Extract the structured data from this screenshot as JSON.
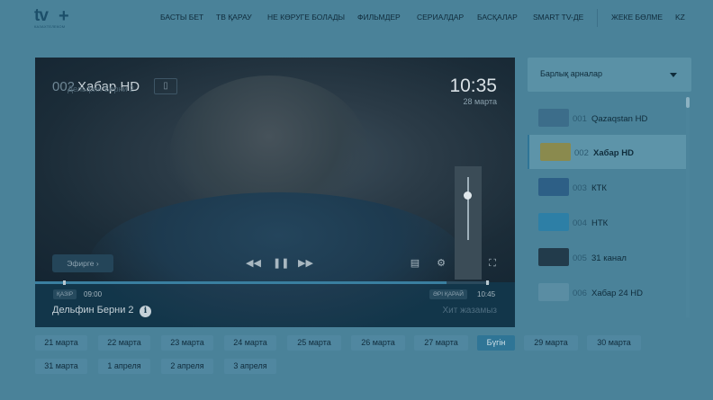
{
  "header": {
    "logo_main": "tv",
    "logo_plus": "+",
    "logo_sub": "КАЗАХТЕЛЕКОМ",
    "nav": [
      {
        "label": "БАСТЫ БЕТ"
      },
      {
        "label": "ТВ ҚАРАУ"
      },
      {
        "label": "НЕ КӨРУГЕ БОЛАДЫ"
      },
      {
        "label": "ФИЛЬМДЕР"
      },
      {
        "label": "СЕРИАЛДАР"
      },
      {
        "label": "БАСҚАЛАР"
      },
      {
        "label": "SMART TV-ДЕ"
      }
    ],
    "account": "ЖЕКЕ БӨЛМЕ",
    "lang": "KZ"
  },
  "player": {
    "channel_number": "002",
    "channel_name": "Хабар HD",
    "programme_ghost": "Дельфин Берни 2",
    "clock": "10:35",
    "date": "28 марта",
    "air_button": "Эфирге",
    "start_tag": "ҚАЗІР",
    "start_time": "09:00",
    "end_tag": "ӘРІ ҚАРАЙ",
    "end_time": "10:45",
    "programme_title": "Дельфин Берни 2",
    "programme_genre": "Хит жазамыз",
    "progress": 0.905,
    "volume": 0.75
  },
  "sidebar": {
    "dropdown_label": "Барлық арналар",
    "channels": [
      {
        "num": "001",
        "name": "Qazaqstan HD",
        "logo_color": "#3c6d8a"
      },
      {
        "num": "002",
        "name": "Хабар HD",
        "logo_color": "#8a8a4e",
        "active": true
      },
      {
        "num": "003",
        "name": "КТК",
        "logo_color": "#2d5f86"
      },
      {
        "num": "004",
        "name": "НТК",
        "logo_color": "#2d7fa6"
      },
      {
        "num": "005",
        "name": "31 канал",
        "logo_color": "#223b4b"
      },
      {
        "num": "006",
        "name": "Хабар 24 HD",
        "logo_color": "#5a8da3"
      }
    ]
  },
  "dates": [
    {
      "label": "21 марта"
    },
    {
      "label": "22 марта"
    },
    {
      "label": "23 марта"
    },
    {
      "label": "24 марта"
    },
    {
      "label": "25 марта"
    },
    {
      "label": "26 марта"
    },
    {
      "label": "27 марта"
    },
    {
      "label": "Бүгін",
      "selected": true
    },
    {
      "label": "29 марта"
    },
    {
      "label": "30 марта"
    },
    {
      "label": "31 марта"
    },
    {
      "label": "1 апреля"
    },
    {
      "label": "2 апреля"
    },
    {
      "label": "3 апреля"
    }
  ],
  "colors": {
    "page_bg": "#4a8299",
    "accent": "#2f7596",
    "player_bg": "#12364a"
  }
}
